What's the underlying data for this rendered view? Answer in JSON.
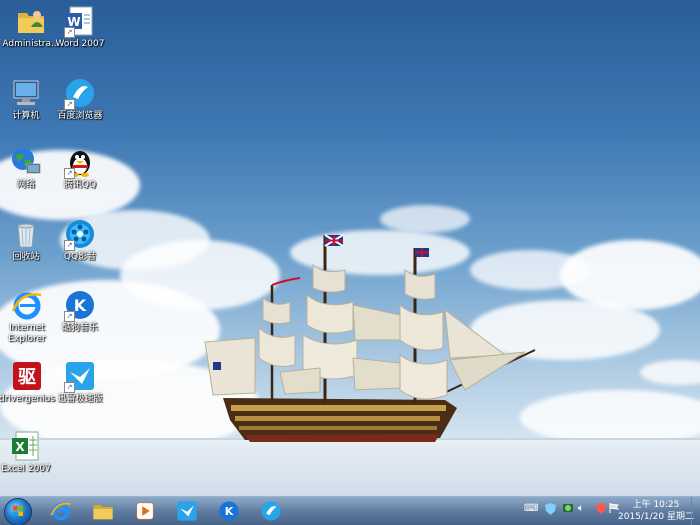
{
  "desktop": {
    "icons": [
      {
        "label": "Administra..."
      },
      {
        "label": "Word 2007"
      },
      {
        "label": "计算机"
      },
      {
        "label": "百度浏览器"
      },
      {
        "label": "网络"
      },
      {
        "label": "腾讯QQ"
      },
      {
        "label": "回收站"
      },
      {
        "label": "QQ影音"
      },
      {
        "label": "Internet Explorer"
      },
      {
        "label": "酷狗音乐"
      },
      {
        "label": "drivergenius"
      },
      {
        "label": "迅雷极速版"
      },
      {
        "label": "Excel 2007"
      }
    ]
  },
  "taskbar": {
    "clock_time": "上午 10:25",
    "clock_date": "2015/1/20 星期二"
  },
  "colors": {
    "taskbar": "#4f6f96",
    "ie_blue": "#1e90ff",
    "excel_green": "#1e7b34",
    "word_blue": "#2a5caa",
    "drivergenius_red": "#c0141a",
    "thunder_blue": "#2aa4e8"
  }
}
